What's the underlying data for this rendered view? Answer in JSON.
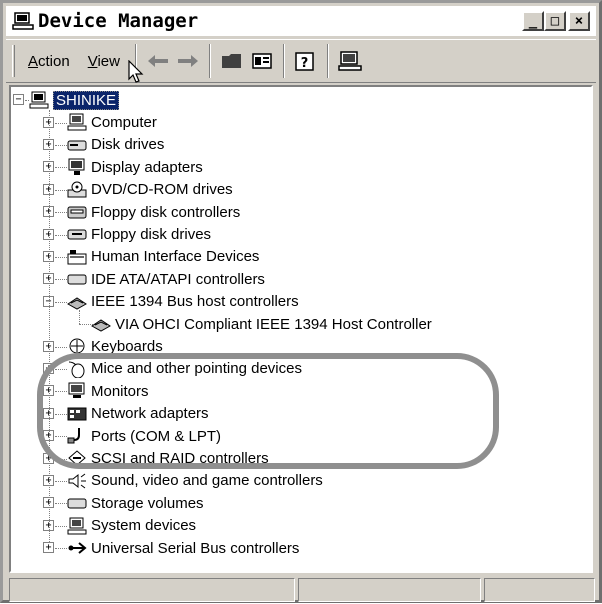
{
  "window": {
    "title": "Device Manager",
    "controls": {
      "minimize": "_",
      "maximize": "□",
      "close": "×"
    }
  },
  "menu": [
    {
      "label": "Action",
      "accel": "A",
      "rest": "ction"
    },
    {
      "label": "View",
      "accel": "V",
      "rest": "iew"
    }
  ],
  "toolbar": {
    "buttons": [
      "back-icon",
      "forward-icon",
      "folder-icon",
      "properties-icon",
      "help-icon",
      "scan-hardware-icon"
    ]
  },
  "tree": {
    "root": "SHINIKE",
    "categories": [
      {
        "label": "Computer",
        "icon": "computer-icon",
        "expanded": false
      },
      {
        "label": "Disk drives",
        "icon": "disk-drive-icon",
        "expanded": false
      },
      {
        "label": "Display adapters",
        "icon": "display-adapter-icon",
        "expanded": false
      },
      {
        "label": "DVD/CD-ROM drives",
        "icon": "dvd-drive-icon",
        "expanded": false
      },
      {
        "label": "Floppy disk controllers",
        "icon": "floppy-controller-icon",
        "expanded": false
      },
      {
        "label": "Floppy disk drives",
        "icon": "floppy-drive-icon",
        "expanded": false
      },
      {
        "label": "Human Interface Devices",
        "icon": "hid-icon",
        "expanded": false
      },
      {
        "label": "IDE ATA/ATAPI controllers",
        "icon": "ide-controller-icon",
        "expanded": false
      },
      {
        "label": "IEEE 1394 Bus host controllers",
        "icon": "ieee1394-icon",
        "expanded": true,
        "children": [
          "VIA OHCI Compliant IEEE 1394 Host Controller"
        ]
      },
      {
        "label": "Keyboards",
        "icon": "keyboard-icon",
        "expanded": false
      },
      {
        "label": "Mice and other pointing devices",
        "icon": "mouse-icon",
        "expanded": false
      },
      {
        "label": "Monitors",
        "icon": "monitor-icon",
        "expanded": false
      },
      {
        "label": "Network adapters",
        "icon": "network-adapter-icon",
        "expanded": false
      },
      {
        "label": "Ports (COM & LPT)",
        "icon": "port-icon",
        "expanded": false
      },
      {
        "label": "SCSI and RAID controllers",
        "icon": "scsi-icon",
        "expanded": false
      },
      {
        "label": "Sound, video and game controllers",
        "icon": "sound-icon",
        "expanded": false
      },
      {
        "label": "Storage volumes",
        "icon": "storage-volume-icon",
        "expanded": false
      },
      {
        "label": "System devices",
        "icon": "system-device-icon",
        "expanded": false
      },
      {
        "label": "Universal Serial Bus controllers",
        "icon": "usb-icon",
        "expanded": false
      }
    ]
  },
  "colors": {
    "selection": "#0a246a",
    "chrome": "#d4d0c8",
    "highlight_ring": "#8f8f8f"
  }
}
